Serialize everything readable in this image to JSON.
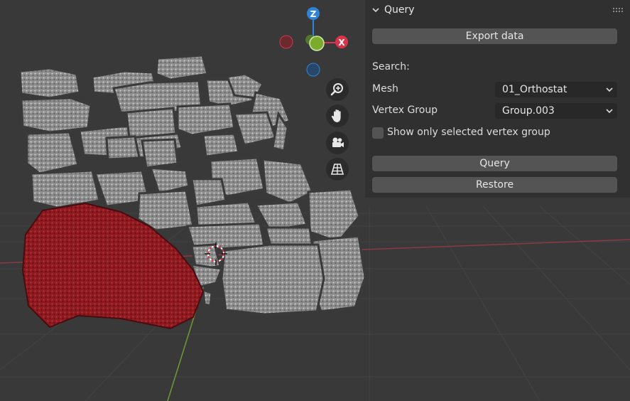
{
  "gizmo": {
    "z_label": "Z",
    "x_label": "X",
    "axis_colors": {
      "x": "#d8344a",
      "y": "#7cab2b",
      "z": "#2f84d6"
    }
  },
  "navigation": {
    "icons": [
      "zoom-icon",
      "hand-icon",
      "camera-icon",
      "grid-icon"
    ]
  },
  "panel": {
    "title": "Query",
    "export_button": "Export data",
    "search_label": "Search:",
    "mesh_label": "Mesh",
    "mesh_value": "01_Orthostat",
    "vertex_group_label": "Vertex Group",
    "vertex_group_value": "Group.003",
    "show_selected_label": "Show only selected vertex group",
    "show_selected_checked": false,
    "query_button": "Query",
    "restore_button": "Restore"
  }
}
